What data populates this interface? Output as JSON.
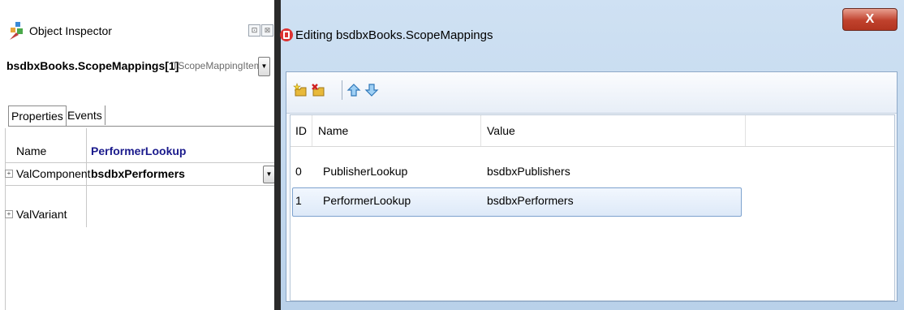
{
  "object_inspector": {
    "title": "Object Inspector",
    "pin_glyph": "⊡",
    "close_glyph": "⊠",
    "selected_object": "bsdbxBooks.ScopeMappings[1]",
    "selected_type": "TScopeMappingItem",
    "tabs": [
      {
        "label": "Properties",
        "active": true
      },
      {
        "label": "Events",
        "active": false
      }
    ],
    "properties": [
      {
        "name": "Name",
        "value": "PerformerLookup",
        "value_color": "#1a1a8c",
        "expandable": false,
        "has_dropdown": false
      },
      {
        "name": "ValComponent",
        "value": "bsdbxPerformers",
        "value_color": "#000000",
        "expandable": true,
        "has_dropdown": true
      },
      {
        "name": "ValVariant",
        "value": "",
        "value_color": "#000000",
        "expandable": true,
        "has_dropdown": false
      }
    ]
  },
  "editor": {
    "title": "Editing bsdbxBooks.ScopeMappings",
    "close_label": "X",
    "toolbar": {
      "buttons": [
        {
          "icon": "add-new-icon"
        },
        {
          "icon": "delete-icon"
        },
        {
          "icon": "move-up-icon"
        },
        {
          "icon": "move-down-icon"
        }
      ]
    },
    "columns": [
      "ID",
      "Name",
      "Value"
    ],
    "rows": [
      {
        "id": "0",
        "name": "PublisherLookup",
        "value": "bsdbxPublishers",
        "selected": false
      },
      {
        "id": "1",
        "name": "PerformerLookup",
        "value": "bsdbxPerformers",
        "selected": true
      }
    ]
  },
  "colors": {
    "accent_blue": "#1a1a8c",
    "close_red": "#c0412c",
    "selection_border": "#7da2ce"
  }
}
